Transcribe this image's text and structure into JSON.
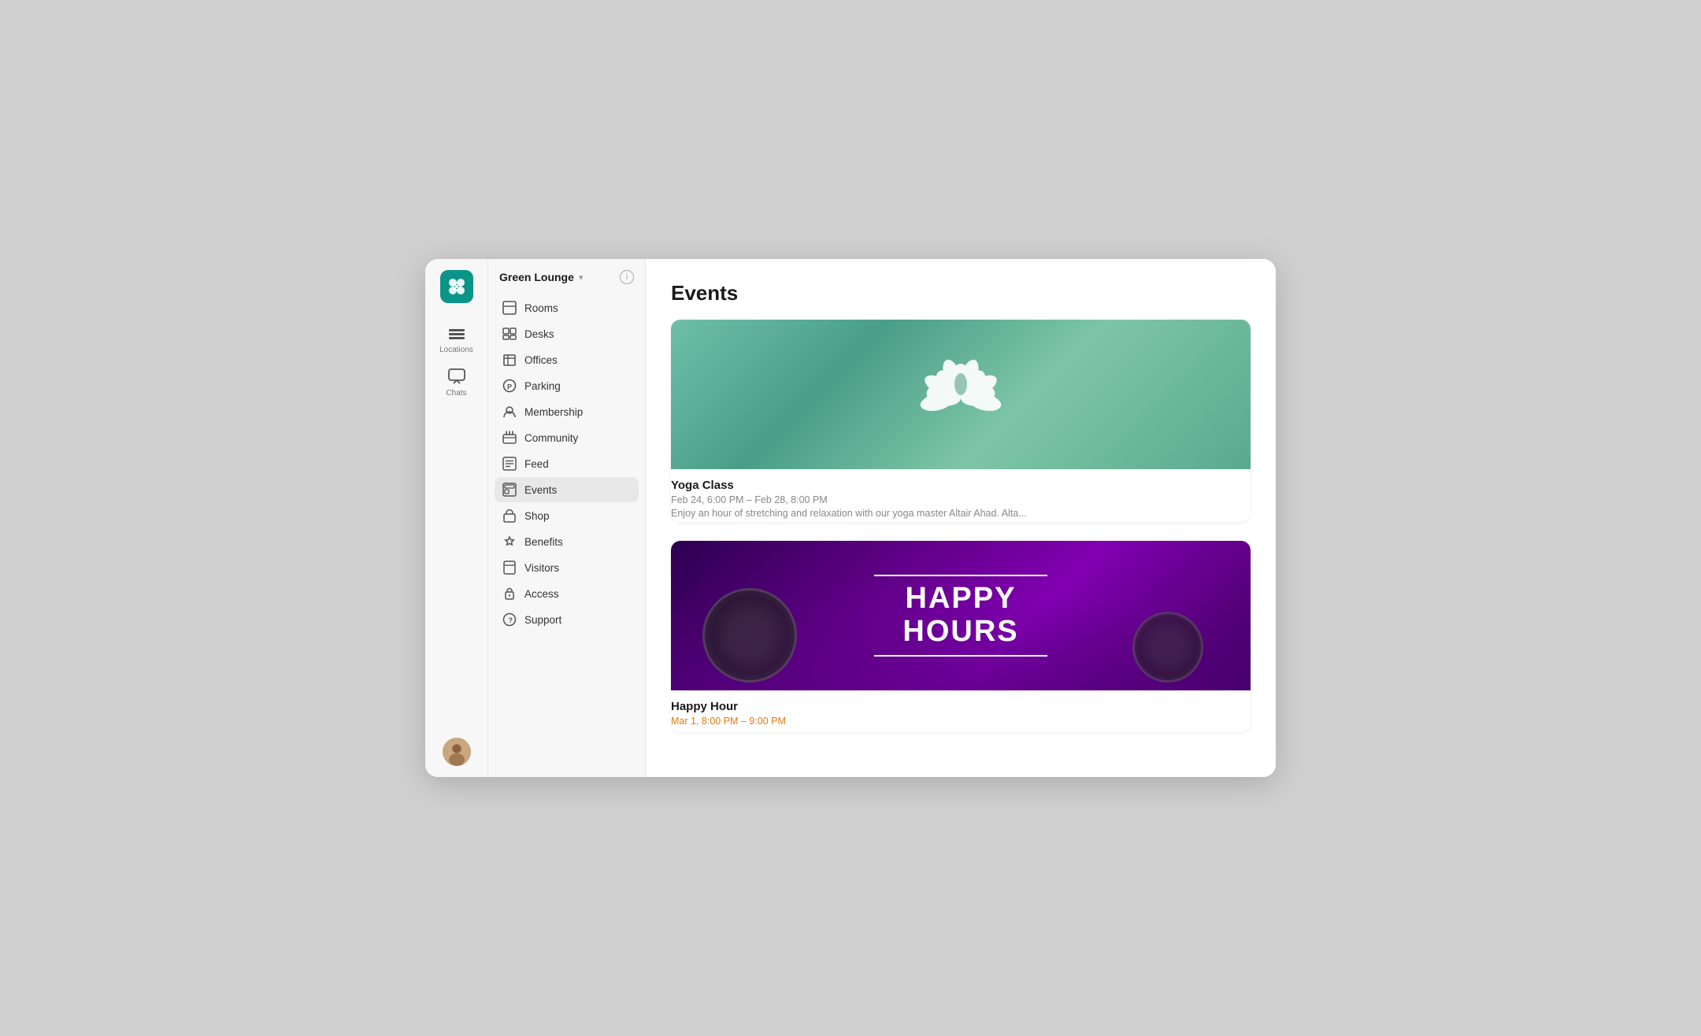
{
  "app": {
    "logo_aria": "App logo",
    "window_title": "Events"
  },
  "rail": {
    "locations_label": "Locations",
    "chats_label": "Chats"
  },
  "sidebar": {
    "title": "Green Lounge",
    "info_label": "i",
    "nav_items": [
      {
        "id": "rooms",
        "label": "Rooms",
        "icon": "rooms"
      },
      {
        "id": "desks",
        "label": "Desks",
        "icon": "desks"
      },
      {
        "id": "offices",
        "label": "Offices",
        "icon": "offices"
      },
      {
        "id": "parking",
        "label": "Parking",
        "icon": "parking"
      },
      {
        "id": "membership",
        "label": "Membership",
        "icon": "membership"
      },
      {
        "id": "community",
        "label": "Community",
        "icon": "community"
      },
      {
        "id": "feed",
        "label": "Feed",
        "icon": "feed"
      },
      {
        "id": "events",
        "label": "Events",
        "icon": "events",
        "active": true
      },
      {
        "id": "shop",
        "label": "Shop",
        "icon": "shop"
      },
      {
        "id": "benefits",
        "label": "Benefits",
        "icon": "benefits"
      },
      {
        "id": "visitors",
        "label": "Visitors",
        "icon": "visitors"
      },
      {
        "id": "access",
        "label": "Access",
        "icon": "access"
      },
      {
        "id": "support",
        "label": "Support",
        "icon": "support"
      }
    ]
  },
  "page": {
    "title": "Events"
  },
  "events": [
    {
      "id": "yoga",
      "name": "Yoga Class",
      "date": "Feb 24, 6:00 PM – Feb 28, 8:00 PM",
      "description": "Enjoy an hour of stretching and relaxation with our yoga master Altair Ahad. Alta...",
      "image_type": "yoga",
      "date_color": "normal"
    },
    {
      "id": "happy-hour",
      "name": "Happy Hour",
      "date": "Mar 1, 8:00 PM – 9:00 PM",
      "description": "",
      "image_type": "happy-hours",
      "image_title_line1": "HAPPY",
      "image_title_line2": "HOURS",
      "date_color": "orange"
    }
  ]
}
